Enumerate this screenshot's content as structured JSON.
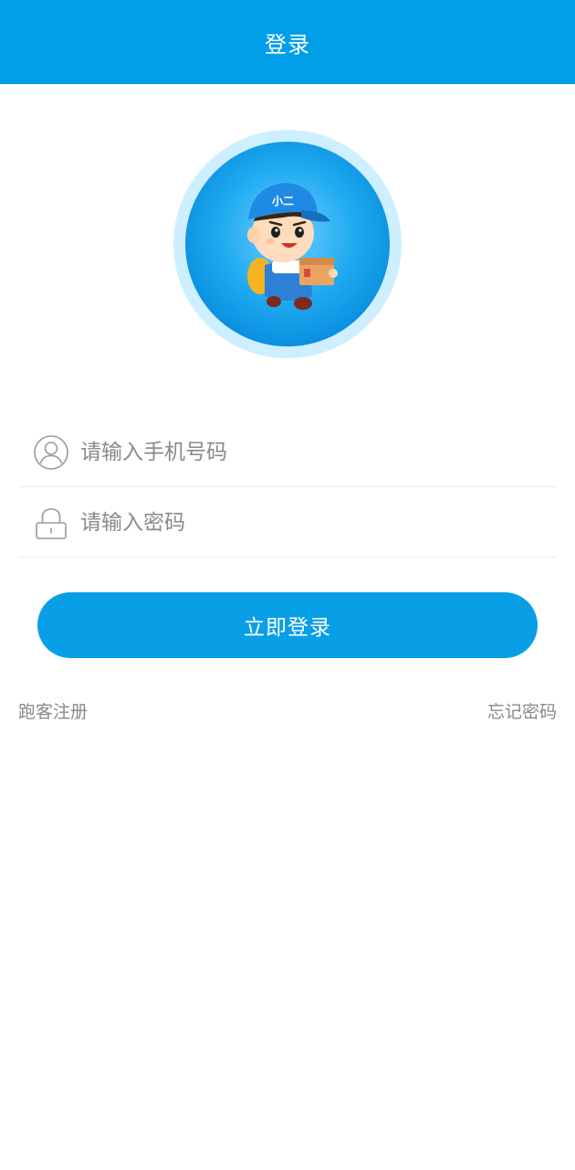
{
  "header": {
    "title": "登录"
  },
  "avatar": {
    "icon": "courier-mascot-icon",
    "cap_text": "小二"
  },
  "form": {
    "phone_placeholder": "请输入手机号码",
    "phone_value": "",
    "password_placeholder": "请输入密码",
    "password_value": "",
    "phone_icon": "user-icon",
    "password_icon": "lock-icon"
  },
  "actions": {
    "login_label": "立即登录",
    "register_label": "跑客注册",
    "forgot_label": "忘记密码"
  },
  "colors": {
    "primary": "#019fe8",
    "button": "#089fe6",
    "link_text": "#8a8a8a",
    "divider": "#ebebeb"
  }
}
